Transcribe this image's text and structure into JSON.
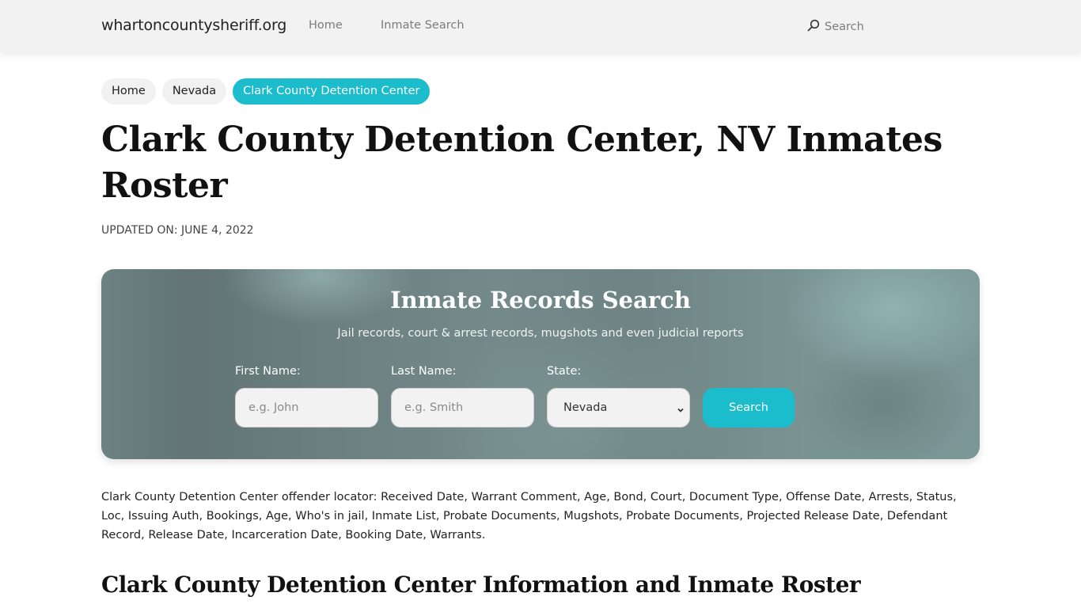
{
  "header": {
    "brand": "whartoncountysheriff.org",
    "nav": [
      {
        "label": "Home"
      },
      {
        "label": "Inmate Search"
      }
    ],
    "search_label": "Search",
    "search_icon": "search-icon"
  },
  "breadcrumb": [
    {
      "label": "Home",
      "active": false
    },
    {
      "label": "Nevada",
      "active": false
    },
    {
      "label": "Clark County Detention Center",
      "active": true
    }
  ],
  "page": {
    "title": "Clark County Detention Center, NV Inmates Roster",
    "updated": "UPDATED ON: JUNE 4, 2022"
  },
  "search_panel": {
    "title": "Inmate Records Search",
    "subtitle": "Jail records, court & arrest records, mugshots and even judicial reports",
    "first_name": {
      "label": "First Name:",
      "placeholder": "e.g. John",
      "value": ""
    },
    "last_name": {
      "label": "Last Name:",
      "placeholder": "e.g. Smith",
      "value": ""
    },
    "state": {
      "label": "State:",
      "selected": "Nevada"
    },
    "button_label": "Search"
  },
  "description": "Clark County Detention Center offender locator: Received Date, Warrant Comment, Age, Bond, Court, Document Type, Offense Date, Arrests, Status, Loc, Issuing Auth, Bookings, Age, Who's in jail, Inmate List, Probate Documents, Mugshots, Probate Documents, Projected Release Date, Defendant Record, Release Date, Incarceration Date, Booking Date, Warrants.",
  "section_title": "Clark County Detention Center Information and Inmate Roster",
  "colors": {
    "accent": "#1bbccb",
    "header_bg": "#f2f2f2",
    "pill_bg": "#f1f1f1"
  }
}
